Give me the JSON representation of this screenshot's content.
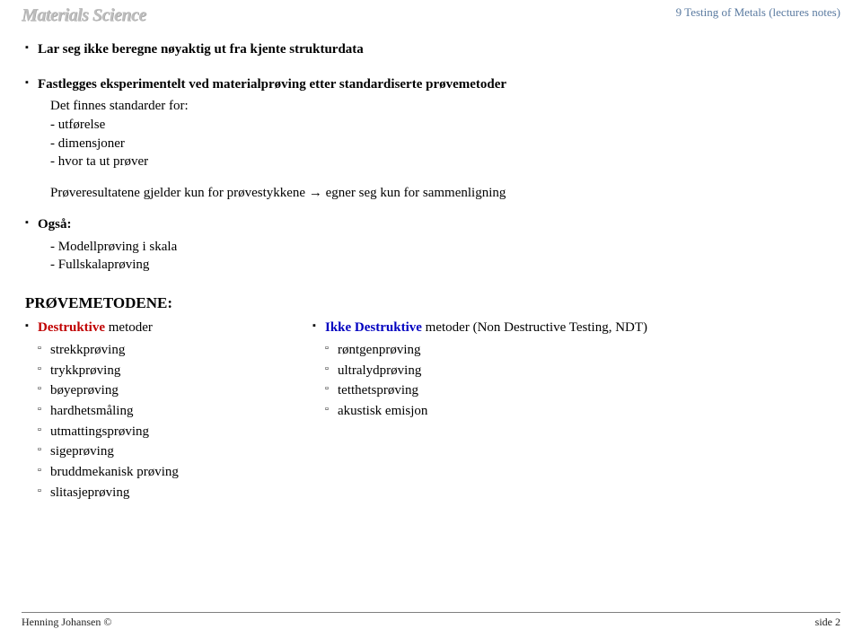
{
  "header": {
    "logo": "Materials Science",
    "right": "9 Testing of Metals (lectures notes)"
  },
  "body": {
    "b1": "Lar seg ikke beregne nøyaktig ut fra kjente strukturdata",
    "b2": "Fastlegges eksperimentelt ved materialprøving etter standardiserte prøvemetoder",
    "b2_sub1": "Det finnes standarder for:",
    "b2_sub2": "- utførelse",
    "b2_sub3": "- dimensjoner",
    "b2_sub4": "- hvor ta ut prøver",
    "b2_sub5": "Prøveresultatene gjelder kun for prøvestykkene     → egner seg kun for sammenligning",
    "b3": "Også:",
    "b3_sub1": "- Modellprøving i skala",
    "b3_sub2": "- Fullskalaprøving",
    "section": "PRØVEMETODENE:",
    "left_head_red": "Destruktive",
    "left_head_rest": " metoder",
    "left_items": {
      "i0": "strekkprøving",
      "i1": "trykkprøving",
      "i2": "bøyeprøving",
      "i3": "hardhetsmåling",
      "i4": "utmattingsprøving",
      "i5": "sigeprøving",
      "i6": "bruddmekanisk prøving",
      "i7": "slitasjeprøving"
    },
    "right_head_blue": "Ikke Destruktive",
    "right_head_rest": " metoder (Non Destructive Testing, NDT)",
    "right_items": {
      "i0": "røntgenprøving",
      "i1": "ultralydprøving",
      "i2": "tetthetsprøving",
      "i3": "akustisk emisjon"
    }
  },
  "footer": {
    "left": "Henning Johansen ©",
    "right": "side 2"
  }
}
